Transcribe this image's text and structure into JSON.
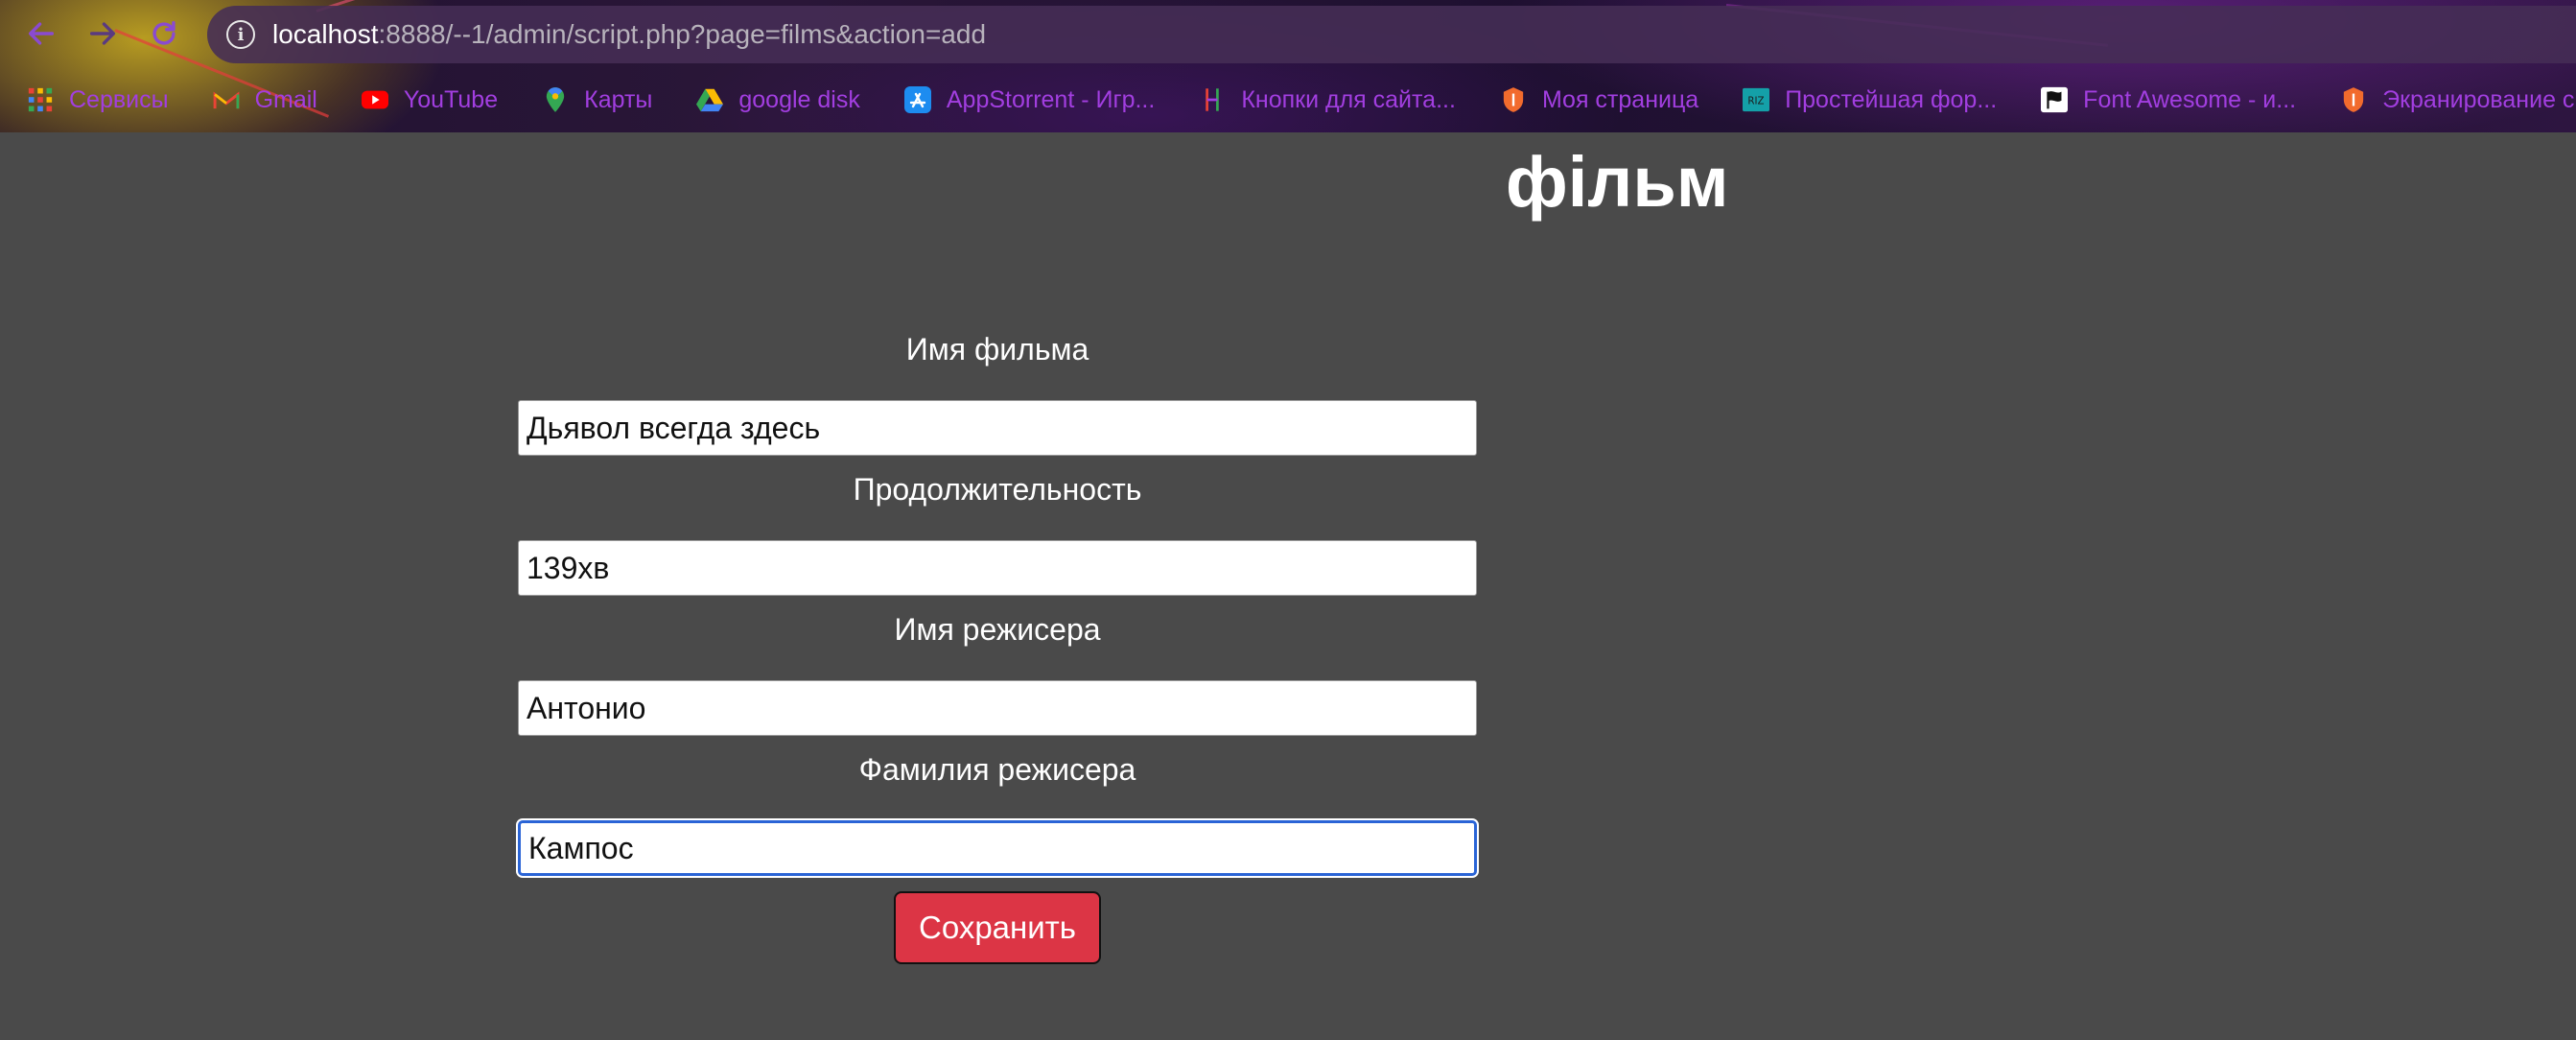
{
  "browser": {
    "url_host": "localhost",
    "url_rest": ":8888/--1/admin/script.php?page=films&action=add",
    "bookmarks": [
      {
        "label": "Сервисы",
        "icon": "apps-grid-icon"
      },
      {
        "label": "Gmail",
        "icon": "gmail-icon"
      },
      {
        "label": "YouTube",
        "icon": "youtube-icon"
      },
      {
        "label": "Карты",
        "icon": "maps-pin-icon"
      },
      {
        "label": "google disk",
        "icon": "google-drive-icon"
      },
      {
        "label": "AppStorrent - Игр...",
        "icon": "appstore-icon"
      },
      {
        "label": "Кнопки для сайта...",
        "icon": "html-h-icon"
      },
      {
        "label": "Моя страница",
        "icon": "orange-shield-icon"
      },
      {
        "label": "Простейшая фор...",
        "icon": "riz-icon"
      },
      {
        "label": "Font Awesome - и...",
        "icon": "flag-icon"
      },
      {
        "label": "Экранирование с...",
        "icon": "orange-shield-icon"
      }
    ]
  },
  "page": {
    "title": "фільм"
  },
  "form": {
    "fields": [
      {
        "label": "Имя фильма",
        "value": "Дьявол всегда здесь"
      },
      {
        "label": "Продолжительность",
        "value": "139хв"
      },
      {
        "label": "Имя режисера",
        "value": "Антонио"
      },
      {
        "label": "Фамилия режисера",
        "value": "Кампос"
      }
    ],
    "submit_label": "Сохранить"
  },
  "colors": {
    "page_background": "#4a4a4a",
    "bookmark_text": "#a23ee0",
    "submit_button": "#dc3545",
    "focus_ring": "#2a64d6"
  }
}
